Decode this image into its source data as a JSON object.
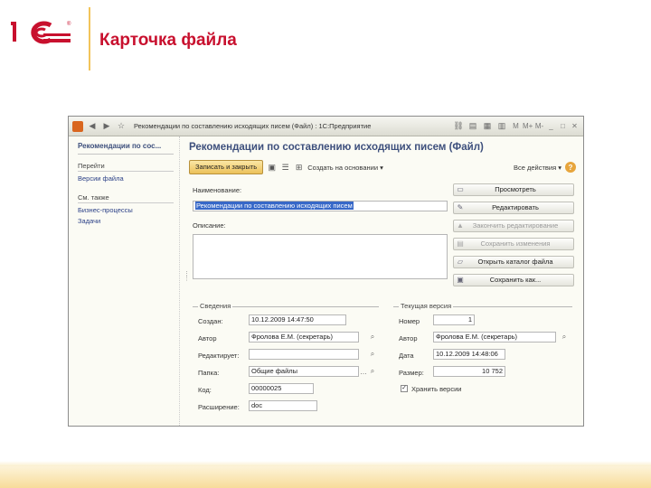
{
  "slide": {
    "title": "Карточка файла",
    "logo_text": "1С"
  },
  "window": {
    "title": "Рекомендации по составлению исходящих писем (Файл) : 1С:Предприятие",
    "title_buttons": [
      "M",
      "M+",
      "M-",
      "_",
      "□",
      "✕"
    ]
  },
  "sidebar": {
    "heading": "Рекомендации по сос...",
    "section_goto": "Перейти",
    "goto_links": [
      "Версии файла"
    ],
    "section_see_also": "См. также",
    "see_also_links": [
      "Бизнес-процессы",
      "Задачи"
    ]
  },
  "form": {
    "title": "Рекомендации по составлению исходящих писем (Файл)",
    "toolbar": {
      "save_close": "Записать и закрыть",
      "create_based": "Создать на основании",
      "all_actions": "Все действия"
    },
    "name_label": "Наименование:",
    "name_value": "Рекомендации по составлению исходящих писем",
    "description_label": "Описание:",
    "actions": [
      {
        "label": "Просмотреть",
        "enabled": true,
        "icon": "view-icon"
      },
      {
        "label": "Редактировать",
        "enabled": true,
        "icon": "edit-icon"
      },
      {
        "label": "Закончить редактирование",
        "enabled": false,
        "icon": "finish-edit-icon"
      },
      {
        "label": "Сохранить изменения",
        "enabled": false,
        "icon": "save-changes-icon"
      },
      {
        "label": "Открыть каталог файла",
        "enabled": true,
        "icon": "folder-icon"
      },
      {
        "label": "Сохранить как...",
        "enabled": true,
        "icon": "save-as-icon"
      }
    ],
    "info_group": {
      "title": "Сведения",
      "created_label": "Создан:",
      "created_value": "10.12.2009 14:47:50",
      "author_label": "Автор",
      "author_value": "Фролова Е.М. (секретарь)",
      "editor_label": "Редактирует:",
      "editor_value": "",
      "folder_label": "Папка:",
      "folder_value": "Общие файлы",
      "code_label": "Код:",
      "code_value": "00000025",
      "ext_label": "Расширение:",
      "ext_value": "doc"
    },
    "version_group": {
      "title": "Текущая версия",
      "number_label": "Номер",
      "number_value": "1",
      "author_label": "Автор",
      "author_value": "Фролова Е.М. (секретарь)",
      "date_label": "Дата",
      "date_value": "10.12.2009 14:48:06",
      "size_label": "Размер:",
      "size_value": "10 752",
      "store_versions_label": "Хранить версии",
      "store_versions_checked": true
    }
  },
  "colors": {
    "title_red": "#c8102e",
    "form_title_blue": "#3d4f7c",
    "primary_button": "#ecc15a",
    "selection": "#3768c8"
  }
}
